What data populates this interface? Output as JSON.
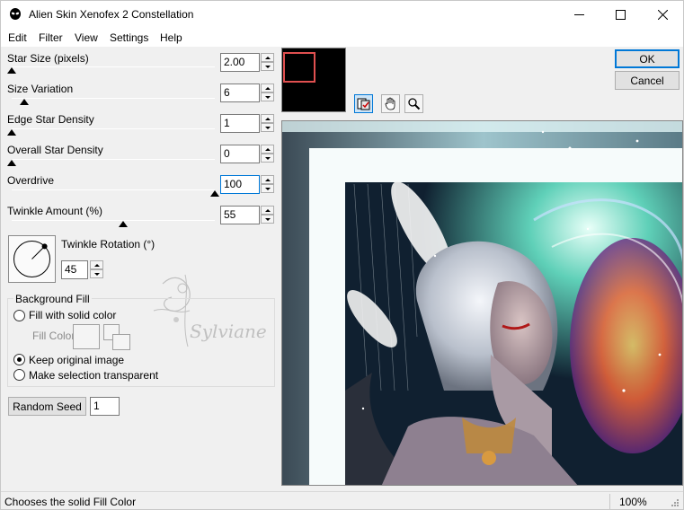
{
  "window": {
    "title": "Alien Skin Xenofex 2 Constellation"
  },
  "menu": [
    "Edit",
    "Filter",
    "View",
    "Settings",
    "Help"
  ],
  "params": [
    {
      "label": "Star Size (pixels)",
      "value": "2.00",
      "fraction": 0.0
    },
    {
      "label": "Size Variation",
      "value": "6",
      "fraction": 0.06
    },
    {
      "label": "Edge Star Density",
      "value": "1",
      "fraction": 0.0
    },
    {
      "label": "Overall Star Density",
      "value": "0",
      "fraction": 0.0
    },
    {
      "label": "Overdrive",
      "value": "100",
      "fraction": 1.0
    },
    {
      "label": "Twinkle Amount (%)",
      "value": "55",
      "fraction": 0.55
    }
  ],
  "rotation": {
    "label": "Twinkle Rotation (°)",
    "value": "45"
  },
  "background_fill": {
    "title": "Background Fill",
    "options": [
      {
        "label": "Fill with solid color",
        "checked": false
      },
      {
        "label": "Keep original image",
        "checked": true
      },
      {
        "label": "Make selection transparent",
        "checked": false
      }
    ],
    "fill_color_label": "Fill Color"
  },
  "random_seed": {
    "label": "Random Seed",
    "value": "1"
  },
  "buttons": {
    "ok": "OK",
    "cancel": "Cancel"
  },
  "watermark": "Sylviane",
  "tools": [
    "preview-toggle-icon",
    "hand-icon",
    "magnifier-icon"
  ],
  "status": {
    "text": "Chooses the solid Fill Color",
    "zoom": "100%"
  },
  "colors": {
    "accent": "#0078d7",
    "thumb_rect": "#e05050"
  }
}
